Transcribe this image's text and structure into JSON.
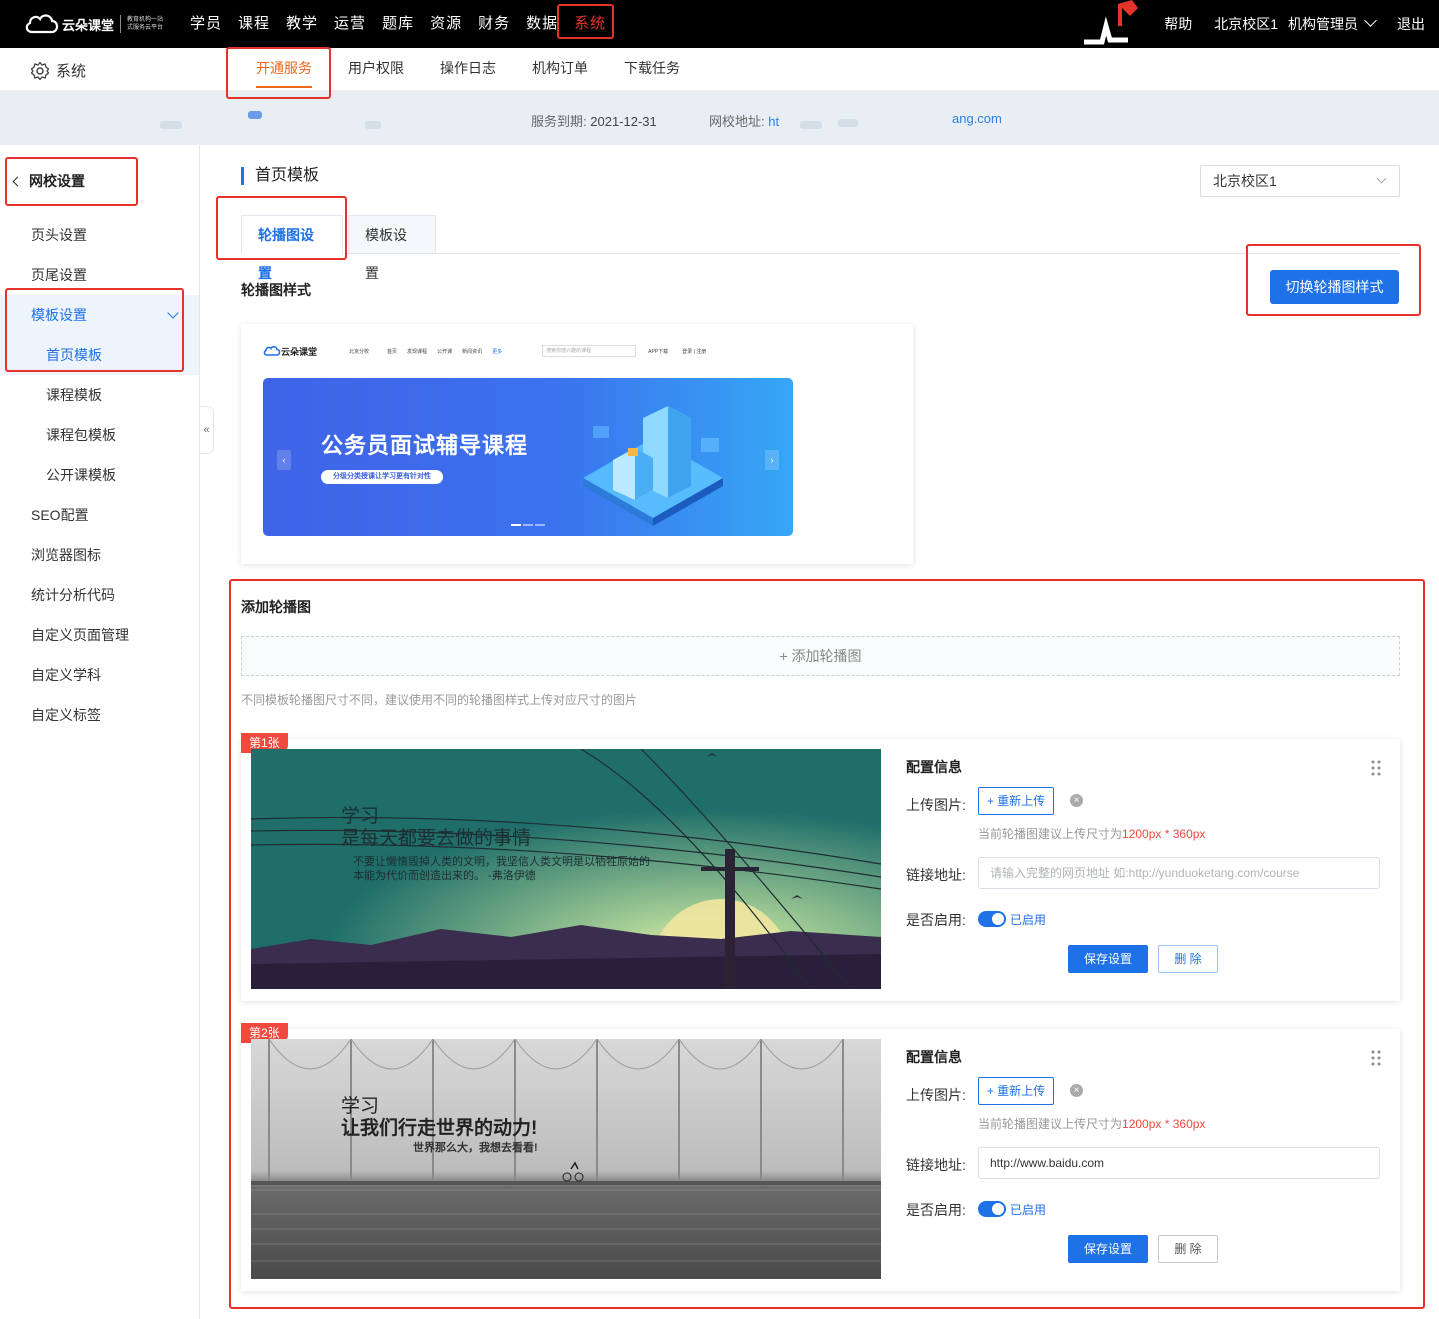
{
  "brand": {
    "name": "云朵课堂",
    "slogan_line1": "教育机构一站",
    "slogan_line2": "式服务云平台"
  },
  "topnav": {
    "items": [
      "学员",
      "课程",
      "教学",
      "运营",
      "题库",
      "资源",
      "财务",
      "数据",
      "系统"
    ],
    "active": "系统"
  },
  "topright": {
    "help": "帮助",
    "campus": "北京校区1",
    "role": "机构管理员",
    "logout": "退出"
  },
  "subbar": {
    "section": "系统",
    "tabs": [
      "开通服务",
      "用户权限",
      "操作日志",
      "机构订单",
      "下载任务"
    ],
    "active": "开通服务"
  },
  "infobar": {
    "expire_label": "服务到期:",
    "expire_date": "2021-12-31",
    "site_label": "网校地址:",
    "site_prefix": "ht",
    "site_suffix": "ang.com"
  },
  "sidebar": {
    "back_label": "网校设置",
    "items": [
      "页头设置",
      "页尾设置",
      "模板设置",
      "首页模板",
      "课程模板",
      "课程包模板",
      "公开课模板",
      "SEO配置",
      "浏览器图标",
      "统计分析代码",
      "自定义页面管理",
      "自定义学科",
      "自定义标签"
    ],
    "active_group": "模板设置",
    "active_item": "首页模板"
  },
  "main": {
    "page_title": "首页模板",
    "campus_select": "北京校区1",
    "tabs": [
      "轮播图设置",
      "模板设置"
    ],
    "active_tab": "轮播图设置",
    "style_section": "轮播图样式",
    "switch_button": "切换轮播图样式",
    "add_section": "添加轮播图",
    "add_button": "+ 添加轮播图",
    "hint": "不同模板轮播图尺寸不同，建议使用不同的轮播图样式上传对应尺寸的图片"
  },
  "preview": {
    "logo": "云朵课堂",
    "campus": "北京分校",
    "nav": [
      "首页",
      "发现课程",
      "公开课",
      "新闻资讯",
      "更多"
    ],
    "search_placeholder": "搜索你感兴趣的课程",
    "app": "APP下载",
    "login": "登录 | 注册",
    "banner_title": "公务员面试辅导课程",
    "banner_pill": "分级分类授课让学习更有针对性"
  },
  "slides": [
    {
      "badge": "第1张",
      "img_line1": "学习",
      "img_line2": "是每天都要去做的事情",
      "img_line3": "不要让懒惰毁掉人类的文明，我坚信人类文明是以牺牲原始的",
      "img_line4": "本能为代价而创造出来的。 -弗洛伊德",
      "config_title": "配置信息",
      "upload_label": "上传图片:",
      "reupload": "+ 重新上传",
      "size_hint_prefix": "当前轮播图建议上传尺寸为",
      "size_hint_value": "1200px * 360px",
      "link_label": "链接地址:",
      "link_value": "",
      "link_placeholder": "请输入完整的网页地址 如:http://yunduoketang.com/course",
      "enable_label": "是否启用:",
      "enable_text": "已启用",
      "save": "保存设置",
      "delete": "删 除"
    },
    {
      "badge": "第2张",
      "img_line1": "学习",
      "img_line2": "让我们行走世界的动力!",
      "img_line3": "世界那么大，我想去看看!",
      "config_title": "配置信息",
      "upload_label": "上传图片:",
      "reupload": "+ 重新上传",
      "size_hint_prefix": "当前轮播图建议上传尺寸为",
      "size_hint_value": "1200px * 360px",
      "link_label": "链接地址:",
      "link_value": "http://www.baidu.com",
      "enable_label": "是否启用:",
      "enable_text": "已启用",
      "save": "保存设置",
      "delete": "删 除"
    }
  ],
  "colors": {
    "primary": "#1f71e8",
    "accent_orange": "#f0661c",
    "highlight_red": "#e5332a",
    "badge_red": "#f04a3e",
    "topbar": "#000000"
  }
}
